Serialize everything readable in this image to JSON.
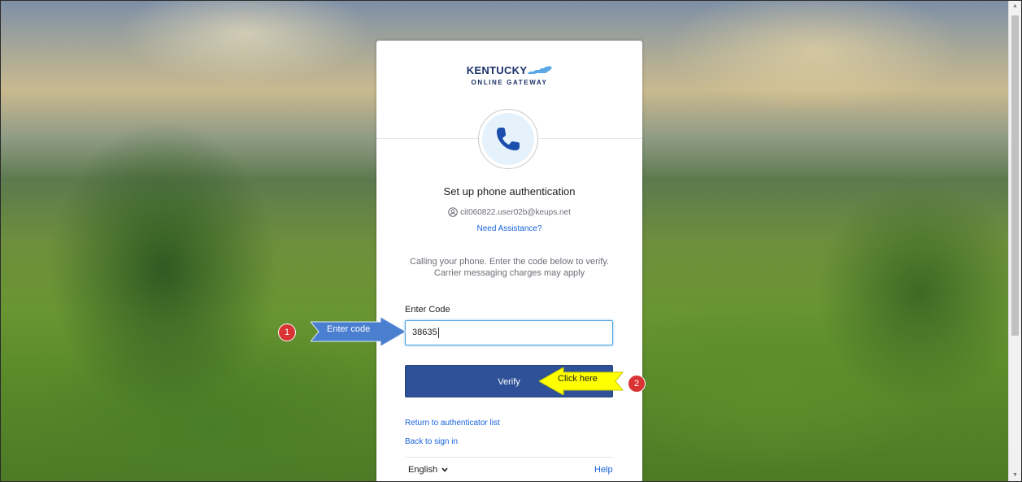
{
  "logo": {
    "top_text": "KENTUCKY",
    "bottom_text": "ONLINE GATEWAY"
  },
  "icons": {
    "phone": "phone-icon",
    "user": "user-icon",
    "language_caret": "chevron-down-icon",
    "scroll_up": "scroll-up-arrow-icon",
    "scroll_down": "scroll-down-arrow-icon"
  },
  "auth": {
    "title": "Set up phone authentication",
    "username": "cit060822.user02b@keups.net",
    "need_assistance": "Need Assistance?",
    "instructions_line1": "Calling your phone.  Enter the code below to verify.",
    "instructions_line2": "Carrier messaging charges may apply",
    "code_label": "Enter Code",
    "code_value": "38635",
    "verify_label": "Verify",
    "return_link": "Return to authenticator list",
    "back_link": "Back to sign in",
    "language": "English",
    "help": "Help"
  },
  "annotations": {
    "step1_number": "1",
    "step1_label": "Enter code",
    "step2_number": "2",
    "step2_label": "Click here"
  },
  "colors": {
    "brand_navy": "#1c3168",
    "button_blue": "#2e5197",
    "link_blue": "#1662dd",
    "badge_red": "#d93333",
    "callout_blue": "#4a7fd0",
    "callout_yellow": "#ffff00"
  }
}
